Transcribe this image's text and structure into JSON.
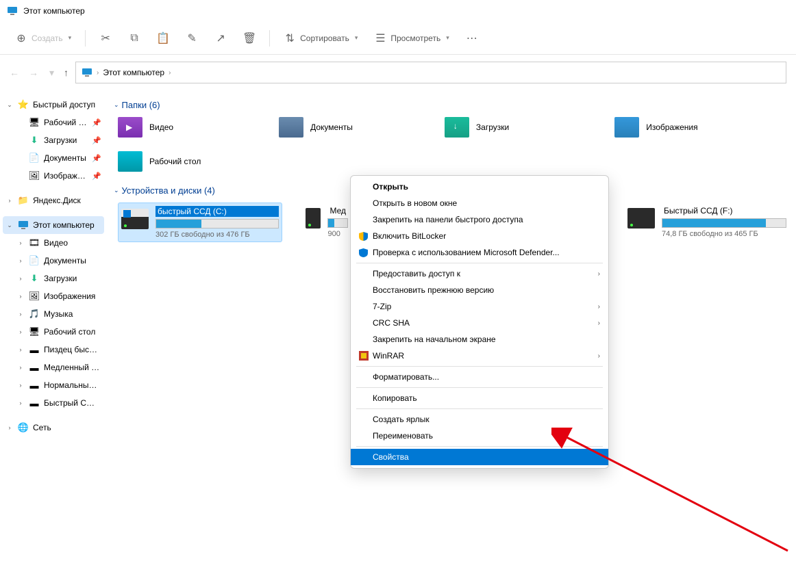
{
  "window": {
    "title": "Этот компьютер"
  },
  "toolbar": {
    "create": "Создать",
    "sort": "Сортировать",
    "view": "Просмотреть"
  },
  "breadcrumb": {
    "root": "Этот компьютер"
  },
  "sidebar": {
    "quick_access": "Быстрый доступ",
    "qa": {
      "desktop": "Рабочий стол",
      "downloads": "Загрузки",
      "documents": "Документы",
      "pictures": "Изображения"
    },
    "yandex": "Яндекс.Диск",
    "this_pc": "Этот компьютер",
    "pc": {
      "videos": "Видео",
      "documents": "Документы",
      "downloads": "Загрузки",
      "pictures": "Изображения",
      "music": "Музыка",
      "desktop": "Рабочий стол",
      "d1": "Пиздец быстрый",
      "d2": "Медленный хард",
      "d3": "Нормальный ха",
      "d4": "Быстрый ССД (F:)"
    },
    "network": "Сеть"
  },
  "content": {
    "folders_header": "Папки (6)",
    "folders": {
      "videos": "Видео",
      "documents": "Документы",
      "downloads": "Загрузки",
      "pictures": "Изображения",
      "desktop": "Рабочий стол"
    },
    "drives_header": "Устройства и диски (4)",
    "drives": {
      "c": {
        "name": "быстрый ССД (C:)",
        "sub": "302 ГБ свободно из 476 ГБ",
        "fill": 37
      },
      "d": {
        "name": "Мед",
        "sub": "900",
        "fill": 30
      },
      "f": {
        "name": "Быстрый ССД (F:)",
        "sub": "74,8 ГБ свободно из 465 ГБ",
        "fill": 84
      }
    }
  },
  "context_menu": {
    "open": "Открыть",
    "open_new": "Открыть в новом окне",
    "pin_quick": "Закрепить на панели быстрого доступа",
    "bitlocker": "Включить BitLocker",
    "defender": "Проверка с использованием Microsoft Defender...",
    "share": "Предоставить доступ к",
    "restore": "Восстановить прежнюю версию",
    "7zip": "7-Zip",
    "crc": "CRC SHA",
    "pin_start": "Закрепить на начальном экране",
    "winrar": "WinRAR",
    "format": "Форматировать...",
    "copy": "Копировать",
    "shortcut": "Создать ярлык",
    "rename": "Переименовать",
    "properties": "Свойства"
  }
}
